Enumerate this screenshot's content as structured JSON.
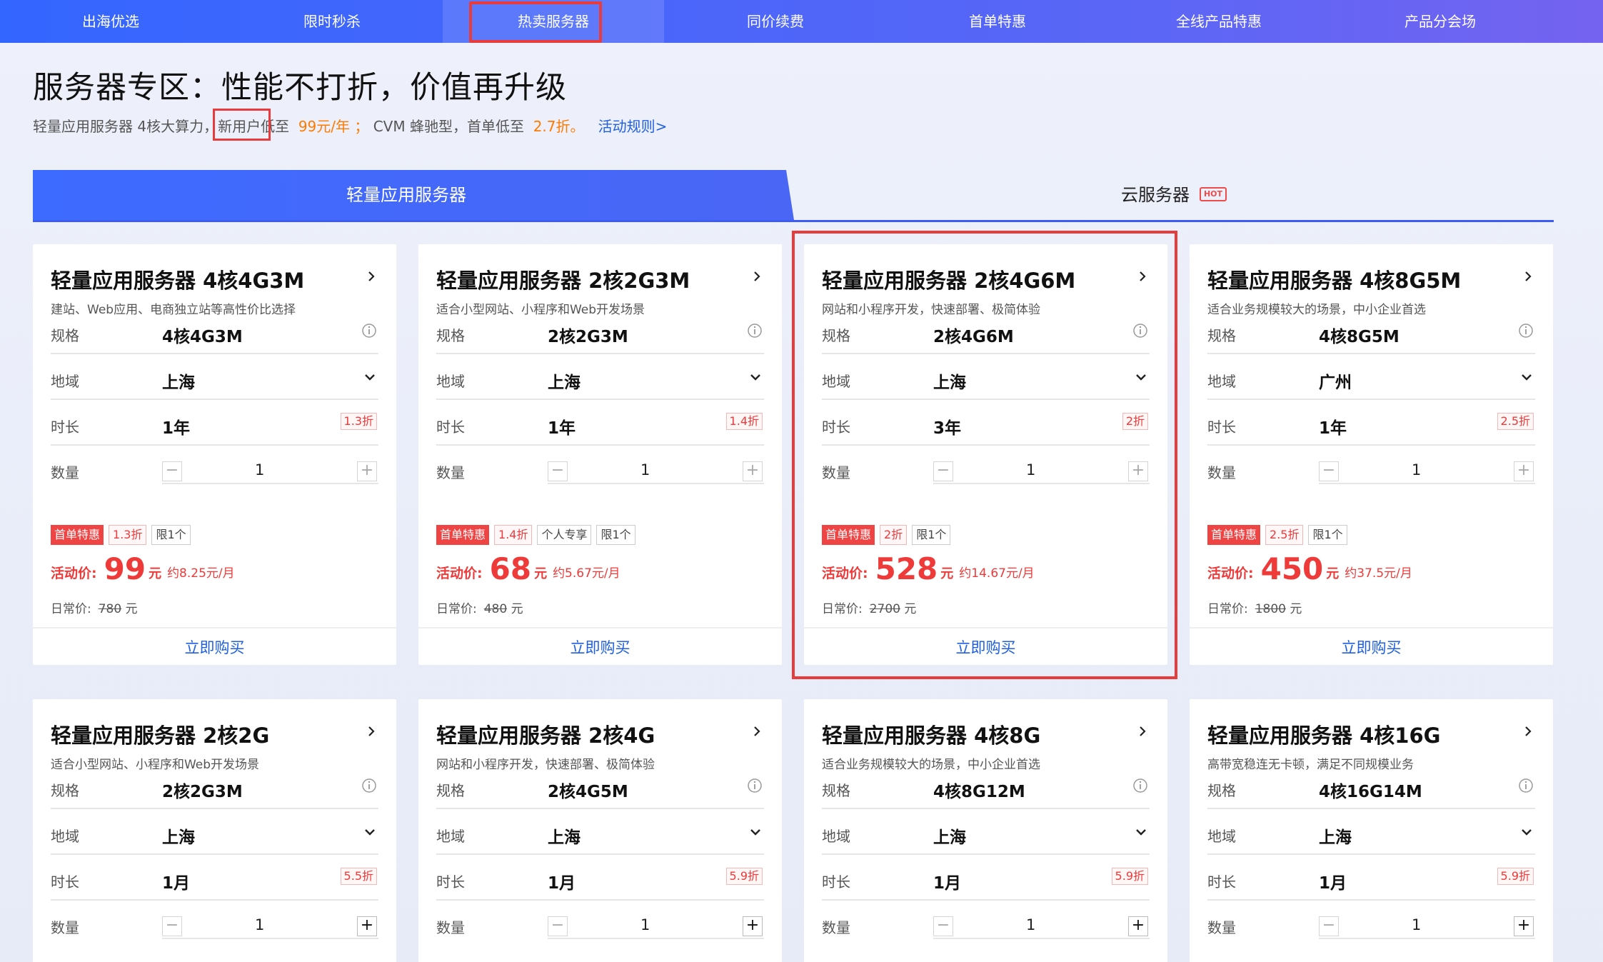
{
  "nav": {
    "items": [
      "出海优选",
      "限时秒杀",
      "热卖服务器",
      "同价续费",
      "首单特惠",
      "全线产品特惠",
      "产品分会场"
    ],
    "active_index": 2
  },
  "header": {
    "title": "服务器专区：性能不打折，价值再升级",
    "sub_a": "轻量应用服务器 4核大算力，",
    "sub_newuser": "新用户",
    "sub_b": "低至 ",
    "sub_price": "99元/年",
    "sub_sep": "；",
    "sub_c": "CVM 蜂驰型，首单低至 ",
    "sub_disc": "2.7折。",
    "sub_link": "活动规则>"
  },
  "tabs": {
    "lighthouse": "轻量应用服务器",
    "cvm": "云服务器",
    "hot": "HOT"
  },
  "labels": {
    "spec": "规格",
    "region": "地域",
    "duration": "时长",
    "quantity": "数量",
    "promo_tag": "首单特惠",
    "price_label": "活动价:",
    "price_unit": "元",
    "regular_label": "日常价:",
    "regular_unit": "元",
    "buy": "立即购买"
  },
  "cards": [
    {
      "title": "轻量应用服务器 4核4G3M",
      "desc": "建站、Web应用、电商独立站等高性价比选择",
      "spec": "4核4G3M",
      "region": "上海",
      "duration": "1年",
      "duration_disc": "1.3折",
      "qty": "1",
      "tags": [
        "1.3折",
        "限1个"
      ],
      "price": "99",
      "monthly": "约8.25元/月",
      "regular": "780"
    },
    {
      "title": "轻量应用服务器 2核2G3M",
      "desc": "适合小型网站、小程序和Web开发场景",
      "spec": "2核2G3M",
      "region": "上海",
      "duration": "1年",
      "duration_disc": "1.4折",
      "qty": "1",
      "tags": [
        "1.4折",
        "个人专享",
        "限1个"
      ],
      "price": "68",
      "monthly": "约5.67元/月",
      "regular": "480"
    },
    {
      "title": "轻量应用服务器 2核4G6M",
      "desc": "网站和小程序开发，快速部署、极简体验",
      "spec": "2核4G6M",
      "region": "上海",
      "duration": "3年",
      "duration_disc": "2折",
      "qty": "1",
      "tags": [
        "2折",
        "限1个"
      ],
      "price": "528",
      "monthly": "约14.67元/月",
      "regular": "2700"
    },
    {
      "title": "轻量应用服务器 4核8G5M",
      "desc": "适合业务规模较大的场景，中小企业首选",
      "spec": "4核8G5M",
      "region": "广州",
      "duration": "1年",
      "duration_disc": "2.5折",
      "qty": "1",
      "tags": [
        "2.5折",
        "限1个"
      ],
      "price": "450",
      "monthly": "约37.5元/月",
      "regular": "1800"
    },
    {
      "title": "轻量应用服务器 2核2G",
      "desc": "适合小型网站、小程序和Web开发场景",
      "spec": "2核2G3M",
      "region": "上海",
      "duration": "1月",
      "duration_disc": "5.5折",
      "qty": "1"
    },
    {
      "title": "轻量应用服务器 2核4G",
      "desc": "网站和小程序开发，快速部署、极简体验",
      "spec": "2核4G5M",
      "region": "上海",
      "duration": "1月",
      "duration_disc": "5.9折",
      "qty": "1"
    },
    {
      "title": "轻量应用服务器 4核8G",
      "desc": "适合业务规模较大的场景，中小企业首选",
      "spec": "4核8G12M",
      "region": "上海",
      "duration": "1月",
      "duration_disc": "5.9折",
      "qty": "1"
    },
    {
      "title": "轻量应用服务器 4核16G",
      "desc": "高带宽稳连无卡顿，满足不同规模业务",
      "spec": "4核16G14M",
      "region": "上海",
      "duration": "1月",
      "duration_disc": "5.9折",
      "qty": "1"
    }
  ]
}
